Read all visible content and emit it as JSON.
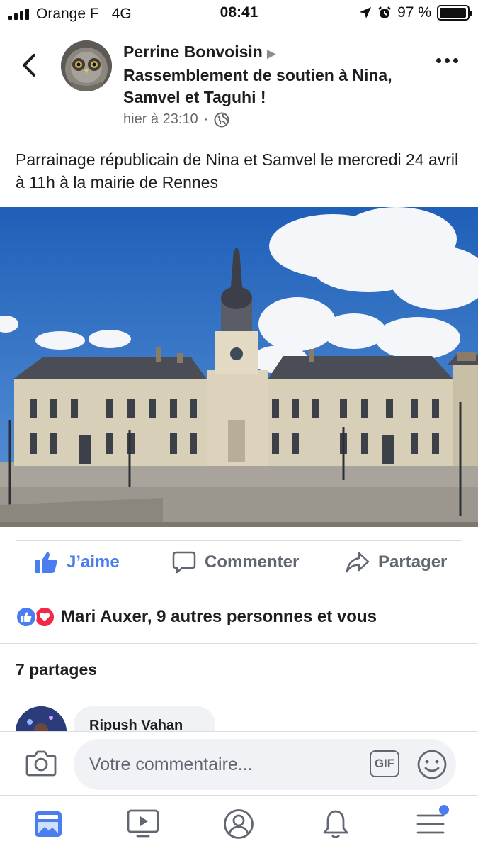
{
  "status_bar": {
    "carrier": "Orange F",
    "network": "4G",
    "time": "08:41",
    "battery": "97 %",
    "battery_level": 0.97
  },
  "post": {
    "author": "Perrine Bonvoisin",
    "group": "Rassemblement de soutien à Nina, Samvel et Taguhi !",
    "timestamp": "hier à 23:10",
    "separator": "·",
    "text": "Parrainage républicain de Nina et Samvel le mercredi 24 avril à 11h à la mairie de Rennes"
  },
  "actions": {
    "like": "J’aime",
    "comment": "Commenter",
    "share": "Partager"
  },
  "reactions": {
    "summary": "Mari Auxer, 9 autres personnes et vous"
  },
  "shares": "7 partages",
  "first_comment": {
    "author": "Ripush Vahan"
  },
  "composer": {
    "placeholder": "Votre commentaire...",
    "gif": "GIF"
  },
  "colors": {
    "accent": "#4a7ef0",
    "love": "#f0284a",
    "muted": "#606770"
  },
  "icons": [
    "back-icon",
    "more-icon",
    "globe-icon",
    "like-icon",
    "comment-icon",
    "share-icon",
    "camera-icon",
    "gif-icon",
    "emoji-icon",
    "news-feed-icon",
    "watch-icon",
    "profile-icon",
    "notifications-icon",
    "menu-icon"
  ]
}
